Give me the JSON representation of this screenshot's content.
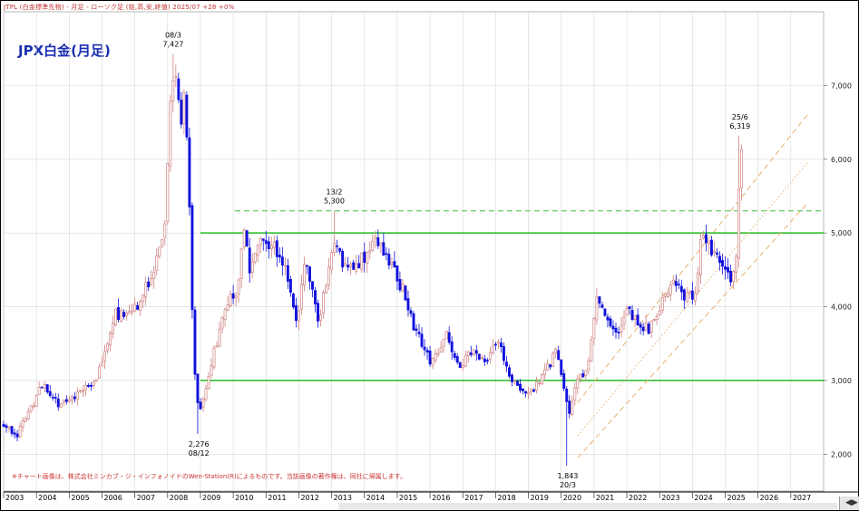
{
  "header": {
    "text": "JTPL (白金標準先物) - 月足 - ローソク足 (始,高,安,終値) 2025/07 +28 +0%"
  },
  "title": "JPX白金(月足)",
  "footnote": "※チャート画像は、株式会社ミンカブ・ジ・インフォノイドのWen-Station(R)によるものです。当該画像の著作権は、同社に帰属します。",
  "chart_data": {
    "type": "candlestick",
    "x_ticks": [
      "2003",
      "2004",
      "2005",
      "2006",
      "2007",
      "2008",
      "2009",
      "2010",
      "2011",
      "2012",
      "2013",
      "2014",
      "2015",
      "2016",
      "2017",
      "2018",
      "2019",
      "2020",
      "2021",
      "2022",
      "2023",
      "2024",
      "2025",
      "2026",
      "2027"
    ],
    "y_ticks": [
      "2,000",
      "3,000",
      "4,000",
      "5,000",
      "6,000",
      "7,000"
    ],
    "ylim": [
      1500,
      8000
    ],
    "xlim": [
      2003.0,
      2028.0
    ],
    "up_color": "#d08080",
    "down_color": "#1010dd",
    "horizontal_lines": [
      {
        "value": 5300,
        "style": "dashed",
        "color": "#44bb44"
      },
      {
        "value": 5000,
        "style": "solid",
        "color": "#22bb22"
      },
      {
        "value": 3000,
        "style": "solid",
        "color": "#22bb22"
      }
    ],
    "channel_lines": [
      {
        "from": [
          2020.5,
          2700
        ],
        "to": [
          2027.5,
          6600
        ],
        "style": "dashed",
        "color": "#e8b070"
      },
      {
        "from": [
          2020.5,
          2250
        ],
        "to": [
          2027.5,
          5950
        ],
        "style": "dotted",
        "color": "#e8b070"
      },
      {
        "from": [
          2020.5,
          1950
        ],
        "to": [
          2027.5,
          5400
        ],
        "style": "dashed",
        "color": "#e8b070"
      }
    ],
    "annotations": [
      {
        "date": "08/3",
        "value": "7,427",
        "x": 2008.17,
        "y": 7427,
        "position": "above"
      },
      {
        "date": "08/12",
        "value": "2,276",
        "x": 2008.95,
        "y": 2276,
        "position": "below"
      },
      {
        "date": "13/2",
        "value": "5,300",
        "x": 2013.08,
        "y": 5300,
        "position": "above"
      },
      {
        "date": "20/3",
        "value": "1,843",
        "x": 2020.2,
        "y": 1843,
        "position": "below"
      },
      {
        "date": "25/6",
        "value": "6,319",
        "x": 2025.45,
        "y": 6319,
        "position": "above"
      }
    ],
    "anchors": [
      [
        2003.0,
        2400
      ],
      [
        2003.4,
        2250
      ],
      [
        2003.9,
        2700
      ],
      [
        2004.2,
        2950
      ],
      [
        2004.7,
        2650
      ],
      [
        2005.2,
        2800
      ],
      [
        2005.8,
        2950
      ],
      [
        2006.4,
        3900
      ],
      [
        2006.9,
        3900
      ],
      [
        2007.4,
        4300
      ],
      [
        2007.9,
        5000
      ],
      [
        2008.1,
        6800
      ],
      [
        2008.2,
        7300
      ],
      [
        2008.4,
        6400
      ],
      [
        2008.5,
        6900
      ],
      [
        2008.65,
        5700
      ],
      [
        2008.8,
        3200
      ],
      [
        2008.95,
        2500
      ],
      [
        2009.3,
        3200
      ],
      [
        2009.8,
        4000
      ],
      [
        2010.2,
        4300
      ],
      [
        2010.3,
        5100
      ],
      [
        2010.5,
        4500
      ],
      [
        2010.9,
        4900
      ],
      [
        2011.3,
        4800
      ],
      [
        2011.7,
        4400
      ],
      [
        2011.9,
        3700
      ],
      [
        2012.2,
        4600
      ],
      [
        2012.6,
        3800
      ],
      [
        2012.9,
        4500
      ],
      [
        2013.1,
        5000
      ],
      [
        2013.4,
        4500
      ],
      [
        2013.7,
        4600
      ],
      [
        2014.0,
        4650
      ],
      [
        2014.4,
        4900
      ],
      [
        2014.8,
        4600
      ],
      [
        2015.2,
        4200
      ],
      [
        2015.5,
        3700
      ],
      [
        2015.8,
        3500
      ],
      [
        2016.0,
        3200
      ],
      [
        2016.5,
        3600
      ],
      [
        2016.9,
        3200
      ],
      [
        2017.3,
        3400
      ],
      [
        2017.7,
        3300
      ],
      [
        2018.1,
        3500
      ],
      [
        2018.5,
        3000
      ],
      [
        2018.8,
        2850
      ],
      [
        2019.2,
        2900
      ],
      [
        2019.6,
        3200
      ],
      [
        2019.9,
        3400
      ],
      [
        2020.1,
        2800
      ],
      [
        2020.25,
        2600
      ],
      [
        2020.5,
        3000
      ],
      [
        2020.8,
        3200
      ],
      [
        2021.1,
        4200
      ],
      [
        2021.4,
        3800
      ],
      [
        2021.7,
        3600
      ],
      [
        2022.0,
        4000
      ],
      [
        2022.3,
        3800
      ],
      [
        2022.7,
        3700
      ],
      [
        2023.0,
        4000
      ],
      [
        2023.4,
        4400
      ],
      [
        2023.8,
        4100
      ],
      [
        2024.1,
        4200
      ],
      [
        2024.3,
        5100
      ],
      [
        2024.6,
        4700
      ],
      [
        2024.9,
        4600
      ],
      [
        2025.2,
        4300
      ],
      [
        2025.35,
        4700
      ],
      [
        2025.45,
        6000
      ],
      [
        2025.55,
        6200
      ]
    ],
    "forced_extremes": [
      {
        "x": 2008.17,
        "high": 7427
      },
      {
        "x": 2008.95,
        "low": 2276
      },
      {
        "x": 2013.08,
        "high": 5300
      },
      {
        "x": 2020.2,
        "low": 1843
      },
      {
        "x": 2025.45,
        "high": 6319
      }
    ]
  }
}
